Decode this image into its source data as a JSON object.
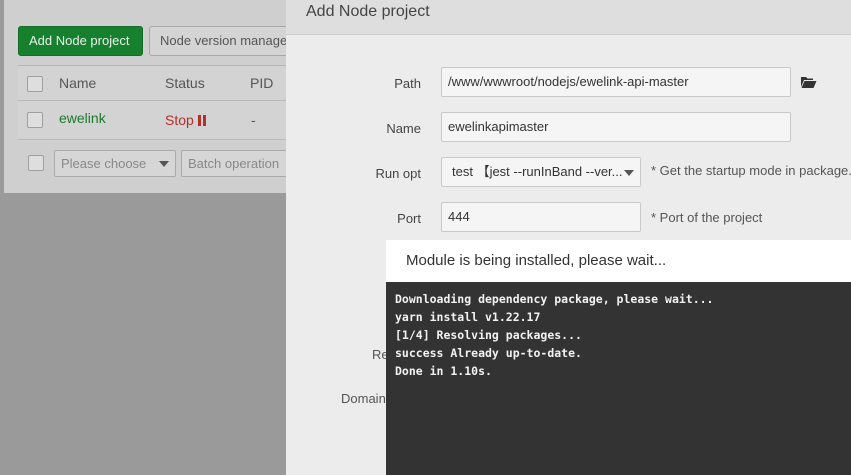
{
  "toolbar": {
    "add_label": "Add Node project",
    "version_label": "Node version manage"
  },
  "table": {
    "headers": [
      "Name",
      "Status",
      "PID"
    ],
    "rows": [
      {
        "name": "ewelink",
        "status": "Stop",
        "pid": "-"
      }
    ]
  },
  "footer": {
    "choose_placeholder": "Please choose",
    "batch_placeholder": "Batch operation"
  },
  "dialog": {
    "title": "Add Node project",
    "fields": {
      "path": {
        "label": "Path",
        "value": "/www/wwwroot/nodejs/ewelink-api-master"
      },
      "name": {
        "label": "Name",
        "value": "ewelinkapimaster"
      },
      "run_opt": {
        "label": "Run opt",
        "value": "test 【jest --runInBand --ver...",
        "hint": "* Get the startup mode in package."
      },
      "port": {
        "label": "Port",
        "value": "444",
        "hint": "* Port of the project"
      },
      "partial_re": {
        "label": "Re"
      },
      "partial_domain": {
        "label": "Domain"
      }
    }
  },
  "install_popup": {
    "title": "Module is being installed, please wait...",
    "console_lines": [
      "Downloading dependency package, please wait...",
      "yarn install v1.22.17",
      "[1/4] Resolving packages...",
      "success Already up-to-date.",
      "Done in 1.10s."
    ]
  },
  "colors": {
    "accent_green": "#17802f",
    "stop_red": "#b2322b",
    "console_bg": "#333333"
  }
}
